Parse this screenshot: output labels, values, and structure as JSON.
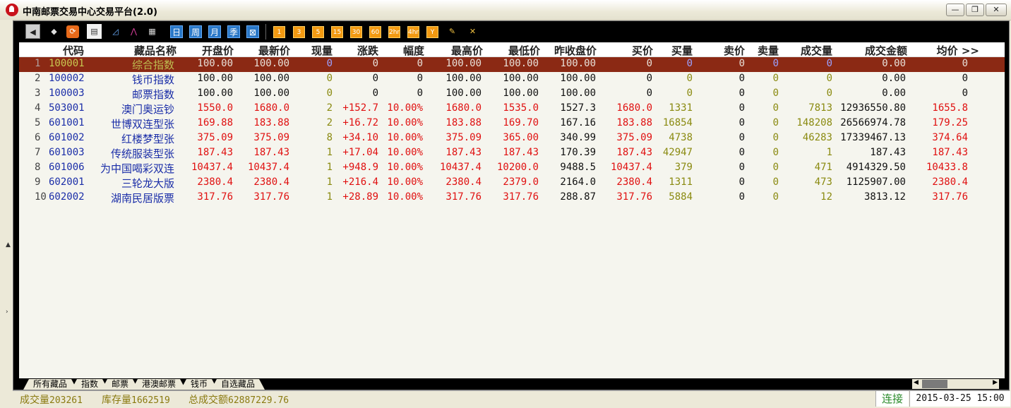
{
  "window": {
    "title": "中南邮票交易中心交易平台(2.0)",
    "minimize_label": "—",
    "restore_label": "❐",
    "close_label": "✕"
  },
  "toolbar": {
    "back_icon": "back-arrow-icon",
    "period_buttons": [
      "日",
      "周",
      "月",
      "季",
      "⊠"
    ],
    "minute_buttons": [
      "1",
      "3",
      "5",
      "15",
      "30",
      "60",
      "2hr",
      "4hr",
      "Y"
    ]
  },
  "table": {
    "headers": [
      "代码",
      "藏品名称",
      "开盘价",
      "最新价",
      "现量",
      "涨跌",
      "幅度",
      "最高价",
      "最低价",
      "昨收盘价",
      "买价",
      "买量",
      "卖价",
      "卖量",
      "成交量",
      "成交金额",
      "均价 >>"
    ],
    "rows": [
      {
        "idx": "1",
        "code": "100001",
        "name": "综合指数",
        "open": "100.00",
        "last": "100.00",
        "vol": "0",
        "chg": "0",
        "pct": "0",
        "high": "100.00",
        "low": "100.00",
        "prev": "100.00",
        "bid": "0",
        "bidvol": "0",
        "ask": "0",
        "askvol": "0",
        "turnover_vol": "0",
        "amount": "0.00",
        "avg": "0"
      },
      {
        "idx": "2",
        "code": "100002",
        "name": "钱币指数",
        "open": "100.00",
        "last": "100.00",
        "vol": "0",
        "chg": "0",
        "pct": "0",
        "high": "100.00",
        "low": "100.00",
        "prev": "100.00",
        "bid": "0",
        "bidvol": "0",
        "ask": "0",
        "askvol": "0",
        "turnover_vol": "0",
        "amount": "0.00",
        "avg": "0"
      },
      {
        "idx": "3",
        "code": "100003",
        "name": "邮票指数",
        "open": "100.00",
        "last": "100.00",
        "vol": "0",
        "chg": "0",
        "pct": "0",
        "high": "100.00",
        "low": "100.00",
        "prev": "100.00",
        "bid": "0",
        "bidvol": "0",
        "ask": "0",
        "askvol": "0",
        "turnover_vol": "0",
        "amount": "0.00",
        "avg": "0"
      },
      {
        "idx": "4",
        "code": "503001",
        "name": "澳门奥运钞",
        "open": "1550.0",
        "last": "1680.0",
        "vol": "2",
        "chg": "+152.7",
        "pct": "10.00%",
        "high": "1680.0",
        "low": "1535.0",
        "prev": "1527.3",
        "bid": "1680.0",
        "bidvol": "1331",
        "ask": "0",
        "askvol": "0",
        "turnover_vol": "7813",
        "amount": "12936550.80",
        "avg": "1655.8"
      },
      {
        "idx": "5",
        "code": "601001",
        "name": "世博双连型张",
        "open": "169.88",
        "last": "183.88",
        "vol": "2",
        "chg": "+16.72",
        "pct": "10.00%",
        "high": "183.88",
        "low": "169.70",
        "prev": "167.16",
        "bid": "183.88",
        "bidvol": "16854",
        "ask": "0",
        "askvol": "0",
        "turnover_vol": "148208",
        "amount": "26566974.78",
        "avg": "179.25"
      },
      {
        "idx": "6",
        "code": "601002",
        "name": "红楼梦型张",
        "open": "375.09",
        "last": "375.09",
        "vol": "8",
        "chg": "+34.10",
        "pct": "10.00%",
        "high": "375.09",
        "low": "365.00",
        "prev": "340.99",
        "bid": "375.09",
        "bidvol": "4738",
        "ask": "0",
        "askvol": "0",
        "turnover_vol": "46283",
        "amount": "17339467.13",
        "avg": "374.64"
      },
      {
        "idx": "7",
        "code": "601003",
        "name": "传统服装型张",
        "open": "187.43",
        "last": "187.43",
        "vol": "1",
        "chg": "+17.04",
        "pct": "10.00%",
        "high": "187.43",
        "low": "187.43",
        "prev": "170.39",
        "bid": "187.43",
        "bidvol": "42947",
        "ask": "0",
        "askvol": "0",
        "turnover_vol": "1",
        "amount": "187.43",
        "avg": "187.43"
      },
      {
        "idx": "8",
        "code": "601006",
        "name": "为中国喝彩双连",
        "open": "10437.4",
        "last": "10437.4",
        "vol": "1",
        "chg": "+948.9",
        "pct": "10.00%",
        "high": "10437.4",
        "low": "10200.0",
        "prev": "9488.5",
        "bid": "10437.4",
        "bidvol": "379",
        "ask": "0",
        "askvol": "0",
        "turnover_vol": "471",
        "amount": "4914329.50",
        "avg": "10433.8"
      },
      {
        "idx": "9",
        "code": "602001",
        "name": "三轮龙大版",
        "open": "2380.4",
        "last": "2380.4",
        "vol": "1",
        "chg": "+216.4",
        "pct": "10.00%",
        "high": "2380.4",
        "low": "2379.0",
        "prev": "2164.0",
        "bid": "2380.4",
        "bidvol": "1311",
        "ask": "0",
        "askvol": "0",
        "turnover_vol": "473",
        "amount": "1125907.00",
        "avg": "2380.4"
      },
      {
        "idx": "10",
        "code": "602002",
        "name": "湖南民居版票",
        "open": "317.76",
        "last": "317.76",
        "vol": "1",
        "chg": "+28.89",
        "pct": "10.00%",
        "high": "317.76",
        "low": "317.76",
        "prev": "288.87",
        "bid": "317.76",
        "bidvol": "5884",
        "ask": "0",
        "askvol": "0",
        "turnover_vol": "12",
        "amount": "3813.12",
        "avg": "317.76"
      }
    ]
  },
  "tabs": [
    "所有藏品",
    "指数",
    "邮票",
    "港澳邮票",
    "钱币",
    "自选藏品"
  ],
  "status": {
    "volume_label": "成交量",
    "volume_value": "203261",
    "stock_label": "库存量",
    "stock_value": "1662519",
    "amount_label": "总成交额",
    "amount_value": "62887229.76",
    "connection": "连接",
    "datetime": "2015-03-25 15:00"
  },
  "colors": {
    "selected_row": "#8b2914",
    "up_red": "#e01010",
    "code_blue": "#1b2ea8",
    "volume_olive": "#8a8a10"
  }
}
